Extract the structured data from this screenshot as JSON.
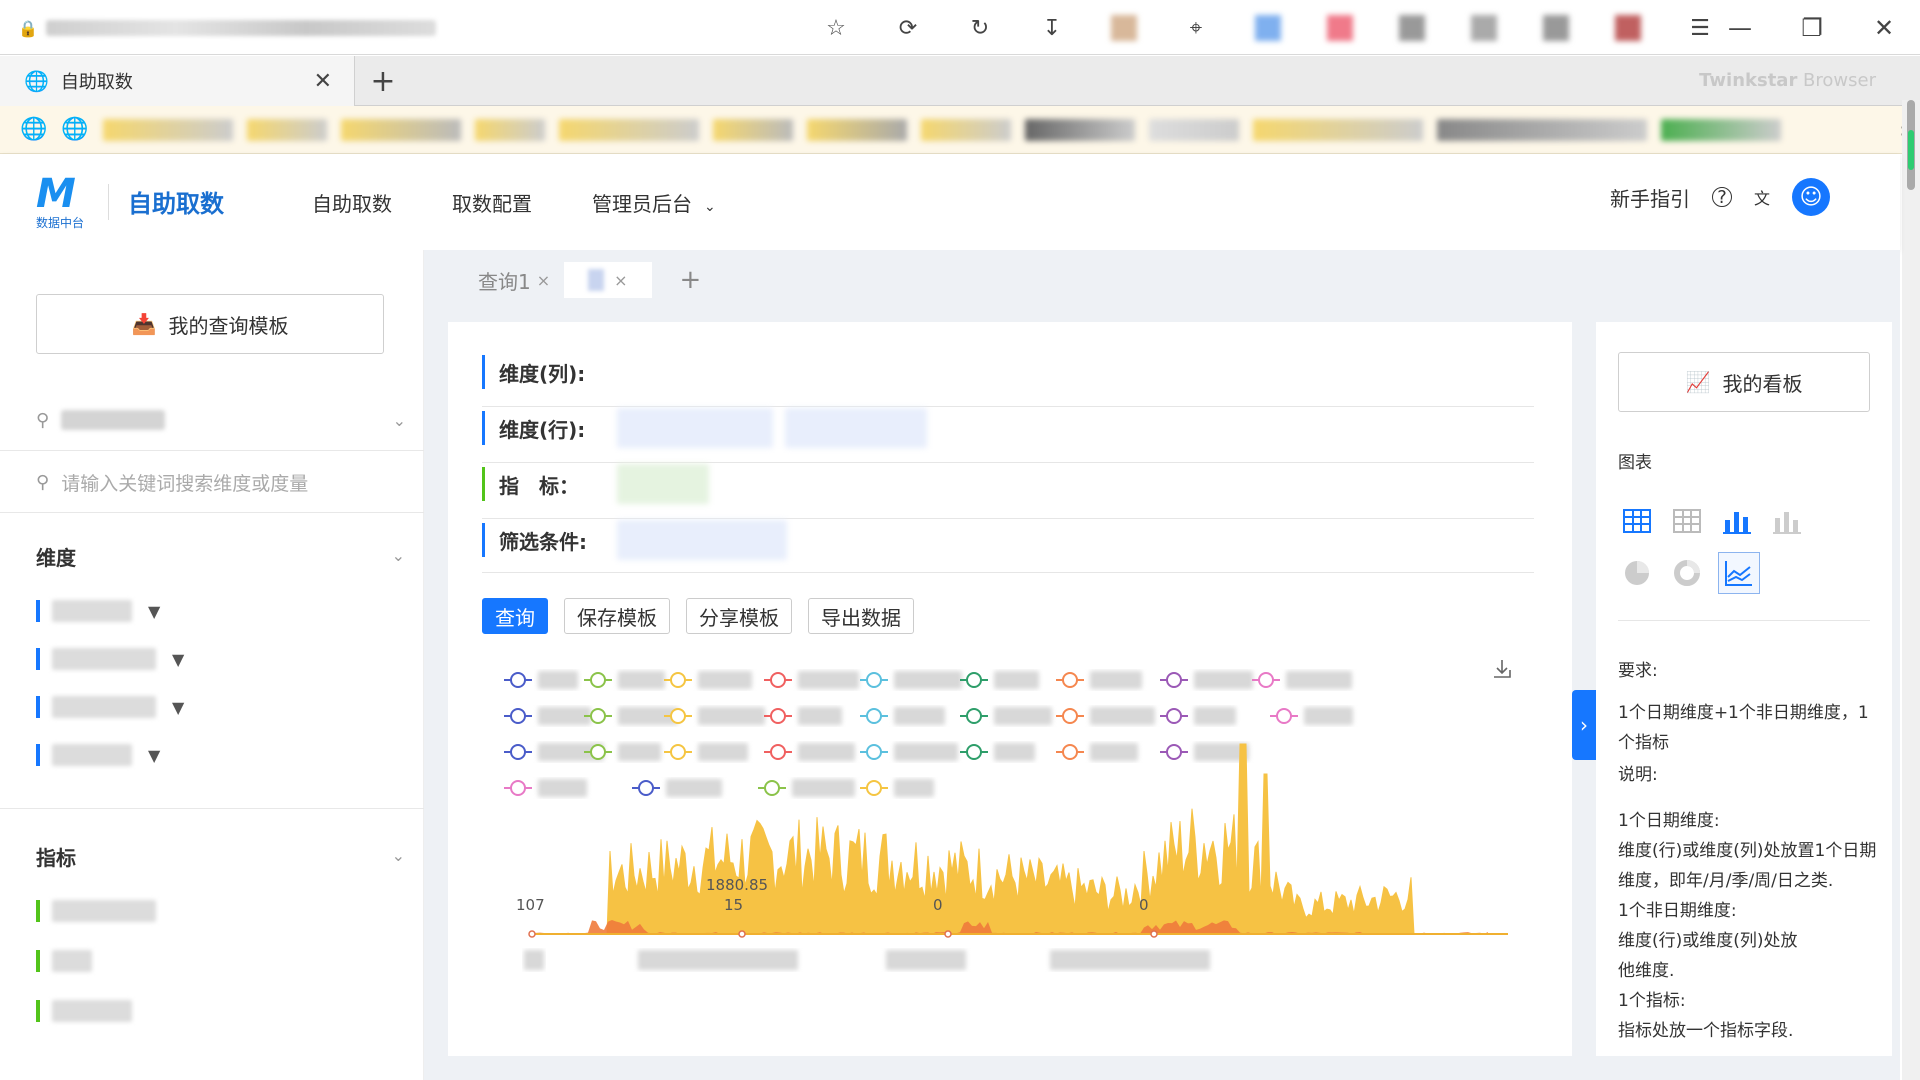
{
  "browser": {
    "tab_title": "自助取数",
    "brand_bold": "Twinkstar",
    "brand_light": " Browser"
  },
  "header": {
    "logo_letter": "M",
    "logo_sub": "数据中台",
    "app_title": "自助取数",
    "nav": [
      "自助取数",
      "取数配置",
      "管理员后台"
    ],
    "guide": "新手指引"
  },
  "sidebar": {
    "template_button": "我的查询模板",
    "search_placeholder": "请输入关键词搜索维度或度量",
    "dimensions_title": "维度",
    "metrics_title": "指标"
  },
  "query_tabs": [
    {
      "label": "查询1"
    },
    {
      "label": ""
    }
  ],
  "conditions": {
    "col_label": "维度(列):",
    "row_label": "维度(行):",
    "metric_label": "指　标：",
    "filter_label": "筛选条件:"
  },
  "buttons": {
    "query": "查询",
    "save": "保存模板",
    "share": "分享模板",
    "export": "导出数据"
  },
  "chart_data": {
    "type": "area",
    "annotations": [
      "107",
      "1880.85",
      "15",
      "0",
      "0"
    ],
    "legend_colors": [
      "#4a5cc9",
      "#8bc34a",
      "#f5c542",
      "#f06060",
      "#5bc0de",
      "#2e9e6a",
      "#f5874f",
      "#9b59b6",
      "#e879c6"
    ],
    "series_colors": {
      "main": "#f6c244",
      "secondary": "#ef7b3c"
    }
  },
  "right_panel": {
    "board_button": "我的看板",
    "chart_section": "图表",
    "req_title": "要求:",
    "req_text": "1个日期维度+1个非日期维度，1个指标",
    "desc_title": "说明:",
    "desc_lines": [
      "1个日期维度:",
      "维度(行)或维度(列)处放置1个日期维度，即年/月/季/周/日之类.",
      "1个非日期维度:",
      "维度(行)或维度(列)处放",
      "他维度.",
      "1个指标:",
      "指标处放一个指标字段."
    ]
  }
}
